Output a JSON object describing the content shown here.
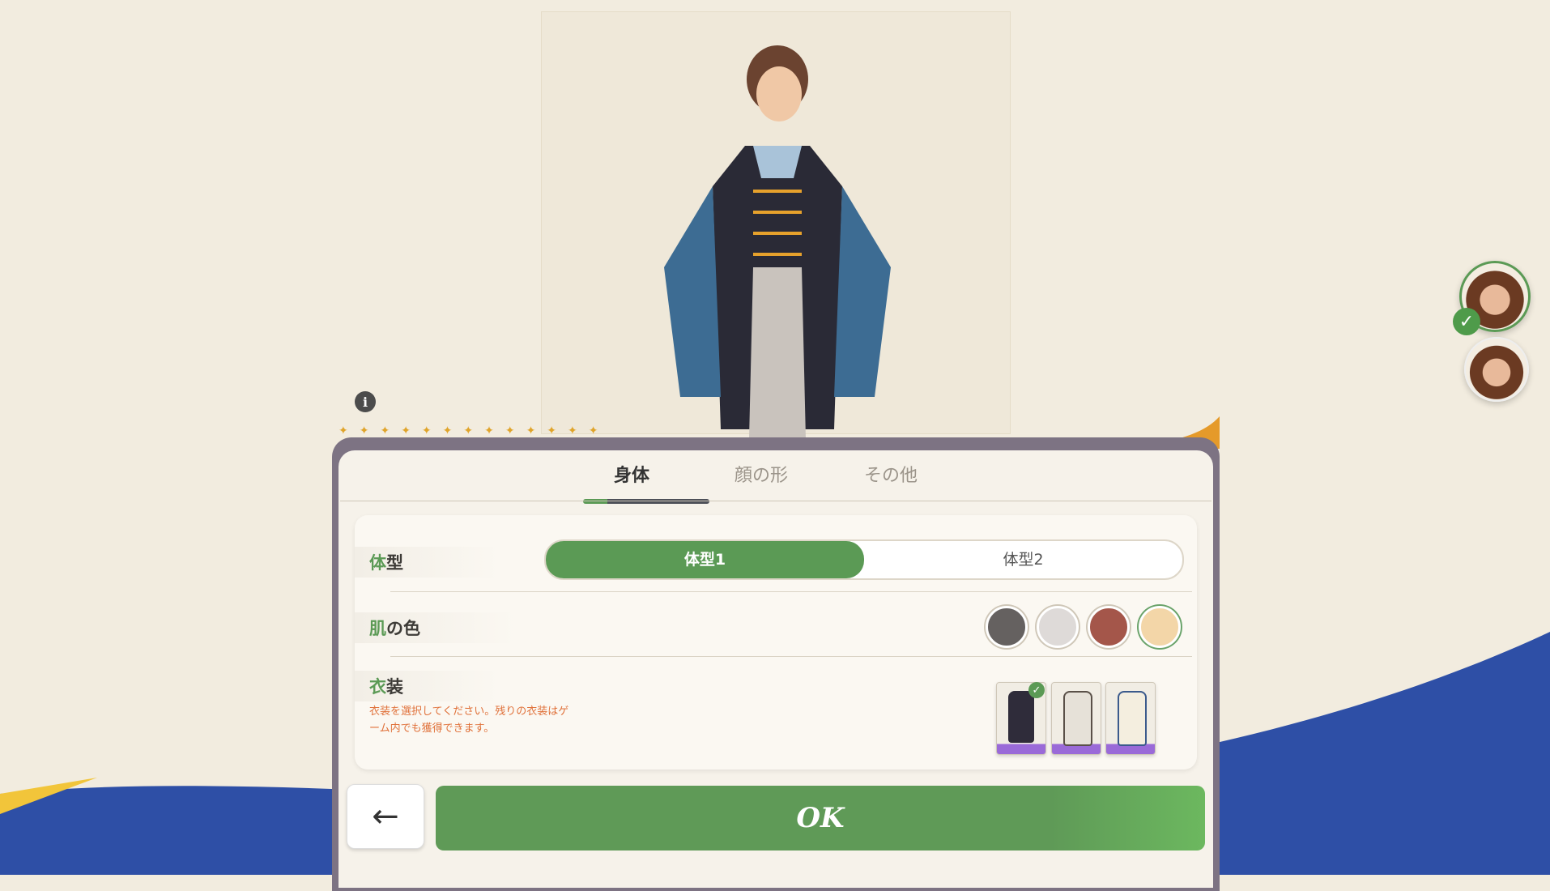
{
  "tabs": [
    {
      "label": "身体"
    },
    {
      "label": "顔の形"
    },
    {
      "label": "その他"
    }
  ],
  "body_type": {
    "label_highlight": "体",
    "label_rest": "型",
    "options": [
      "体型1",
      "体型2"
    ],
    "selected": "体型1"
  },
  "skin_color": {
    "label_highlight": "肌",
    "label_rest": "の色",
    "swatches": [
      "#656160",
      "#dedad8",
      "#a4564a",
      "#f3d6a8"
    ],
    "selected_index": 3
  },
  "costume": {
    "label_highlight": "衣",
    "label_rest": "装",
    "note": "衣装を選択してください。残りの衣装はゲーム内でも獲得できます。",
    "items": [
      "outfit-dark",
      "outfit-white",
      "outfit-cream"
    ],
    "selected_index": 0
  },
  "buttons": {
    "ok_label": "OK",
    "back_icon": "arrow-left-icon"
  },
  "info_icon_glyph": "i",
  "colors": {
    "accent_green": "#5b9a55",
    "note_orange": "#e0713a",
    "wave_blue": "#2e4fa6"
  }
}
